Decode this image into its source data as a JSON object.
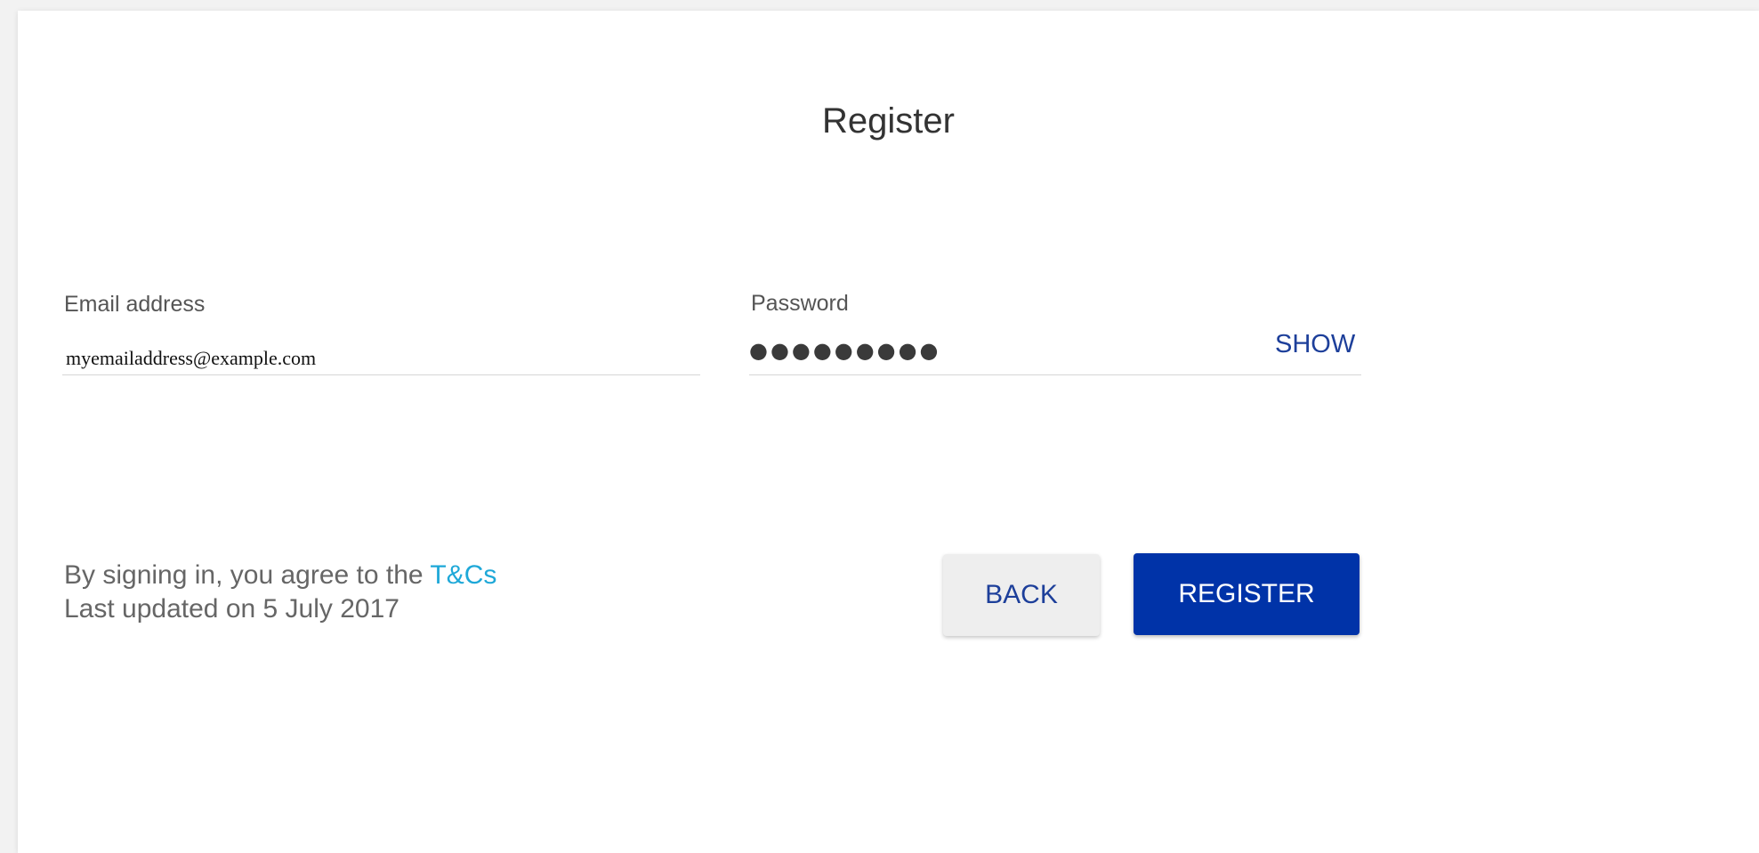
{
  "form": {
    "title": "Register",
    "email": {
      "label": "Email address",
      "value": "myemailaddress@example.com"
    },
    "password": {
      "label": "Password",
      "masked_value": "●●●●●●●●●",
      "show_label": "SHOW"
    }
  },
  "footer": {
    "terms_prefix": "By signing in, you agree to the ",
    "terms_link": "T&Cs",
    "last_updated": "Last updated on 5 July 2017"
  },
  "buttons": {
    "back_label": "BACK",
    "register_label": "REGISTER"
  },
  "colors": {
    "accent": "#0033a8",
    "link": "#1ea8d8",
    "text_link": "#1d3f9a"
  }
}
